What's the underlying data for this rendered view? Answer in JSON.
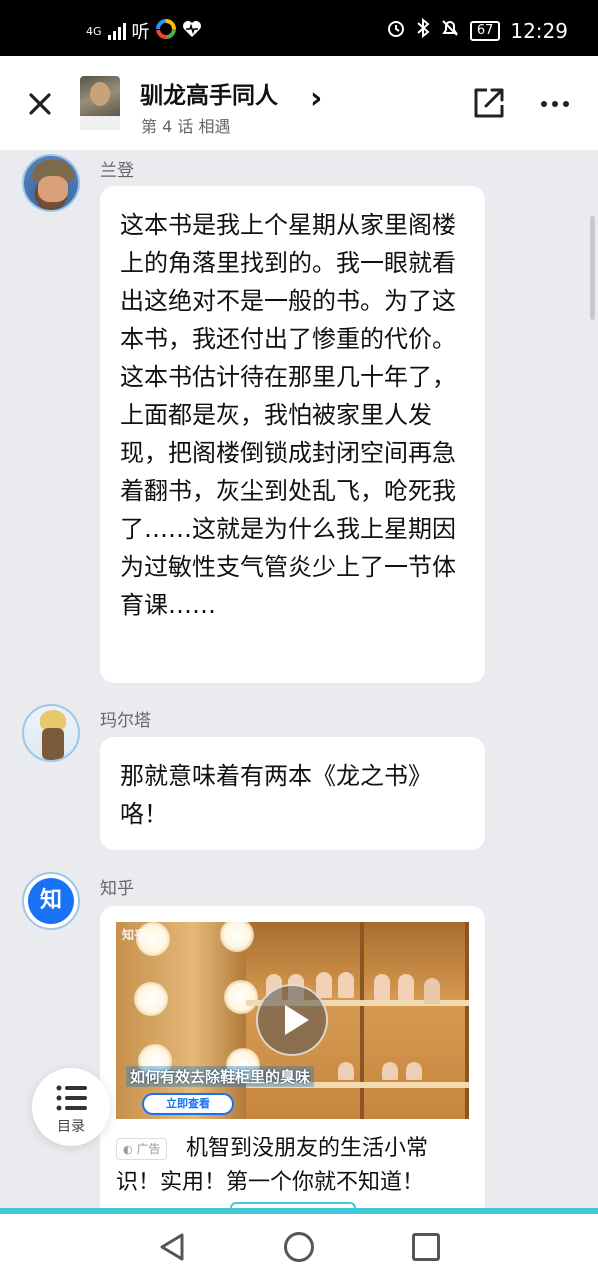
{
  "status_bar": {
    "network": "4G",
    "app_label": "听",
    "battery": "67",
    "time": "12:29"
  },
  "header": {
    "title": "驯龙高手同人",
    "subtitle": "第 4 话 相遇",
    "close_icon": "close-icon",
    "share_icon": "share-icon",
    "more_icon": "more-icon"
  },
  "messages": [
    {
      "sender": "兰登",
      "text": "这本书是我上个星期从家里阁楼上的角落里找到的。我一眼就看出这绝对不是一般的书。为了这本书，我还付出了惨重的代价。这本书估计待在那里几十年了，上面都是灰，我怕被家里人发现，把阁楼倒锁成封闭空间再急着翻书，灰尘到处乱飞，呛死我了……这就是为什么我上星期因为过敏性支气管炎少上了一节体育课……"
    },
    {
      "sender": "玛尔塔",
      "text": "那就意味着有两本《龙之书》咯！"
    },
    {
      "sender": "知乎",
      "avatar_text": "知"
    }
  ],
  "ad": {
    "video_logo": "知乎",
    "video_caption": "如何有效去除鞋柜里的臭味",
    "video_button": "立即查看",
    "tag": "广告",
    "text": "机智到没朋友的生活小常识！实用！第一个你就不知道！"
  },
  "toc_button": {
    "label": "目录"
  },
  "colors": {
    "accent": "#3fc9d8",
    "zhihu_blue": "#1772f6",
    "background": "#e9ebef"
  }
}
